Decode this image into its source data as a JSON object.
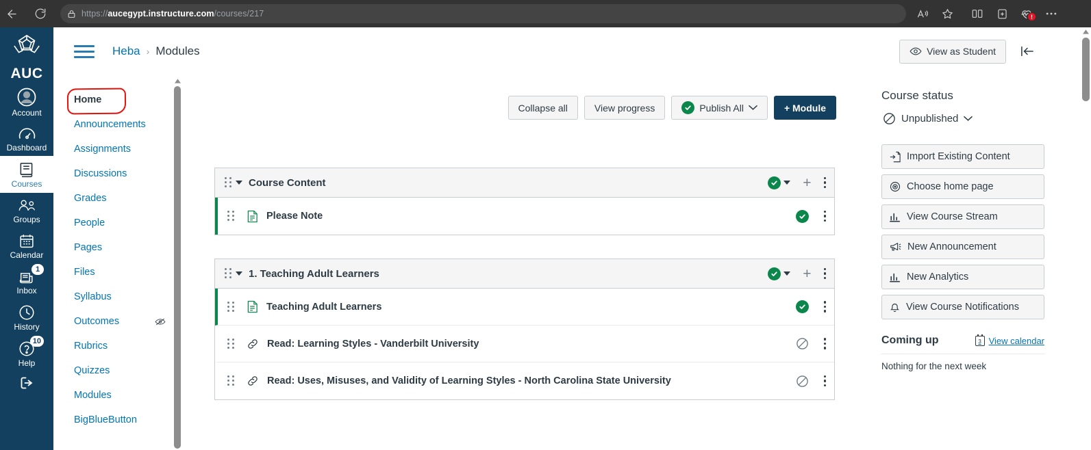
{
  "browser": {
    "back_label": "back-arrow",
    "reload_label": "reload",
    "lock_label": "site-info-lock",
    "url_scheme": "https://",
    "url_host": "aucegypt.instructure.com",
    "url_path": "/courses/217",
    "icons": {
      "read_aloud": "read-aloud-icon",
      "favorite": "favorite-star-icon",
      "split_screen": "split-screen-icon",
      "collections": "collections-icon",
      "browser_essentials": "browser-essentials-icon",
      "browser_essentials_badge": "!",
      "more": "more-settings-icon"
    }
  },
  "global_nav": {
    "logo_text": "AUC",
    "items": [
      {
        "label": "Account",
        "icon": "user-avatar-icon",
        "badge": ""
      },
      {
        "label": "Dashboard",
        "icon": "dashboard-icon",
        "badge": ""
      },
      {
        "label": "Courses",
        "icon": "courses-book-icon",
        "badge": ""
      },
      {
        "label": "Groups",
        "icon": "groups-icon",
        "badge": ""
      },
      {
        "label": "Calendar",
        "icon": "calendar-icon",
        "badge": ""
      },
      {
        "label": "Inbox",
        "icon": "inbox-icon",
        "badge": "1"
      },
      {
        "label": "History",
        "icon": "history-clock-icon",
        "badge": ""
      },
      {
        "label": "Help",
        "icon": "help-question-icon",
        "badge": "10"
      }
    ],
    "logout_icon": "logout-icon"
  },
  "course_nav": {
    "items": [
      {
        "label": "Home",
        "active": true,
        "hidden_icon": false
      },
      {
        "label": "Announcements",
        "active": false,
        "hidden_icon": false
      },
      {
        "label": "Assignments",
        "active": false,
        "hidden_icon": false
      },
      {
        "label": "Discussions",
        "active": false,
        "hidden_icon": false
      },
      {
        "label": "Grades",
        "active": false,
        "hidden_icon": false
      },
      {
        "label": "People",
        "active": false,
        "hidden_icon": false
      },
      {
        "label": "Pages",
        "active": false,
        "hidden_icon": false
      },
      {
        "label": "Files",
        "active": false,
        "hidden_icon": false
      },
      {
        "label": "Syllabus",
        "active": false,
        "hidden_icon": false
      },
      {
        "label": "Outcomes",
        "active": false,
        "hidden_icon": true
      },
      {
        "label": "Rubrics",
        "active": false,
        "hidden_icon": false
      },
      {
        "label": "Quizzes",
        "active": false,
        "hidden_icon": false
      },
      {
        "label": "Modules",
        "active": false,
        "hidden_icon": false
      },
      {
        "label": "BigBlueButton",
        "active": false,
        "hidden_icon": false
      }
    ]
  },
  "header": {
    "menu_icon": "hamburger-menu-icon",
    "breadcrumb_course": "Heba",
    "breadcrumb_sep": "›",
    "breadcrumb_page": "Modules",
    "view_as_student": "View as Student",
    "view_as_student_icon": "eye-icon",
    "collapse_panel_icon": "collapse-panel-icon"
  },
  "toolbar": {
    "collapse_all": "Collapse all",
    "view_progress": "View progress",
    "publish_all": "Publish All",
    "add_module": "+ Module"
  },
  "modules": [
    {
      "title": "Course Content",
      "published": true,
      "items": [
        {
          "title": "Please Note",
          "type_icon": "page-document-icon",
          "published": true
        }
      ]
    },
    {
      "title": "1. Teaching Adult Learners",
      "published": true,
      "items": [
        {
          "title": "Teaching Adult Learners",
          "type_icon": "page-document-icon",
          "published": true
        },
        {
          "title": "Read: Learning Styles - Vanderbilt University",
          "type_icon": "external-link-icon",
          "published": false
        },
        {
          "title": "Read: Uses, Misuses, and Validity of Learning Styles - North Carolina State University",
          "type_icon": "external-link-icon",
          "published": false
        }
      ]
    }
  ],
  "sidebar": {
    "course_status_title": "Course status",
    "course_status_value": "Unpublished",
    "course_status_icon": "circle-slash-icon",
    "buttons": [
      {
        "label": "Import Existing Content",
        "icon": "import-icon"
      },
      {
        "label": "Choose home page",
        "icon": "target-home-icon"
      },
      {
        "label": "View Course Stream",
        "icon": "bar-chart-icon"
      },
      {
        "label": "New Announcement",
        "icon": "megaphone-icon"
      },
      {
        "label": "New Analytics",
        "icon": "bar-chart-icon"
      },
      {
        "label": "View Course Notifications",
        "icon": "bell-icon"
      }
    ],
    "coming_up_title": "Coming up",
    "view_calendar": "View calendar",
    "view_calendar_icon": "calendar-icon",
    "calendar_day_number": "3",
    "coming_up_empty": "Nothing for the next week"
  },
  "colors": {
    "brand_navy": "#14405f",
    "link_blue": "#0374b5",
    "published_green": "#0b874b",
    "annotation_red": "#e8120c",
    "chrome_dark": "#333333"
  }
}
